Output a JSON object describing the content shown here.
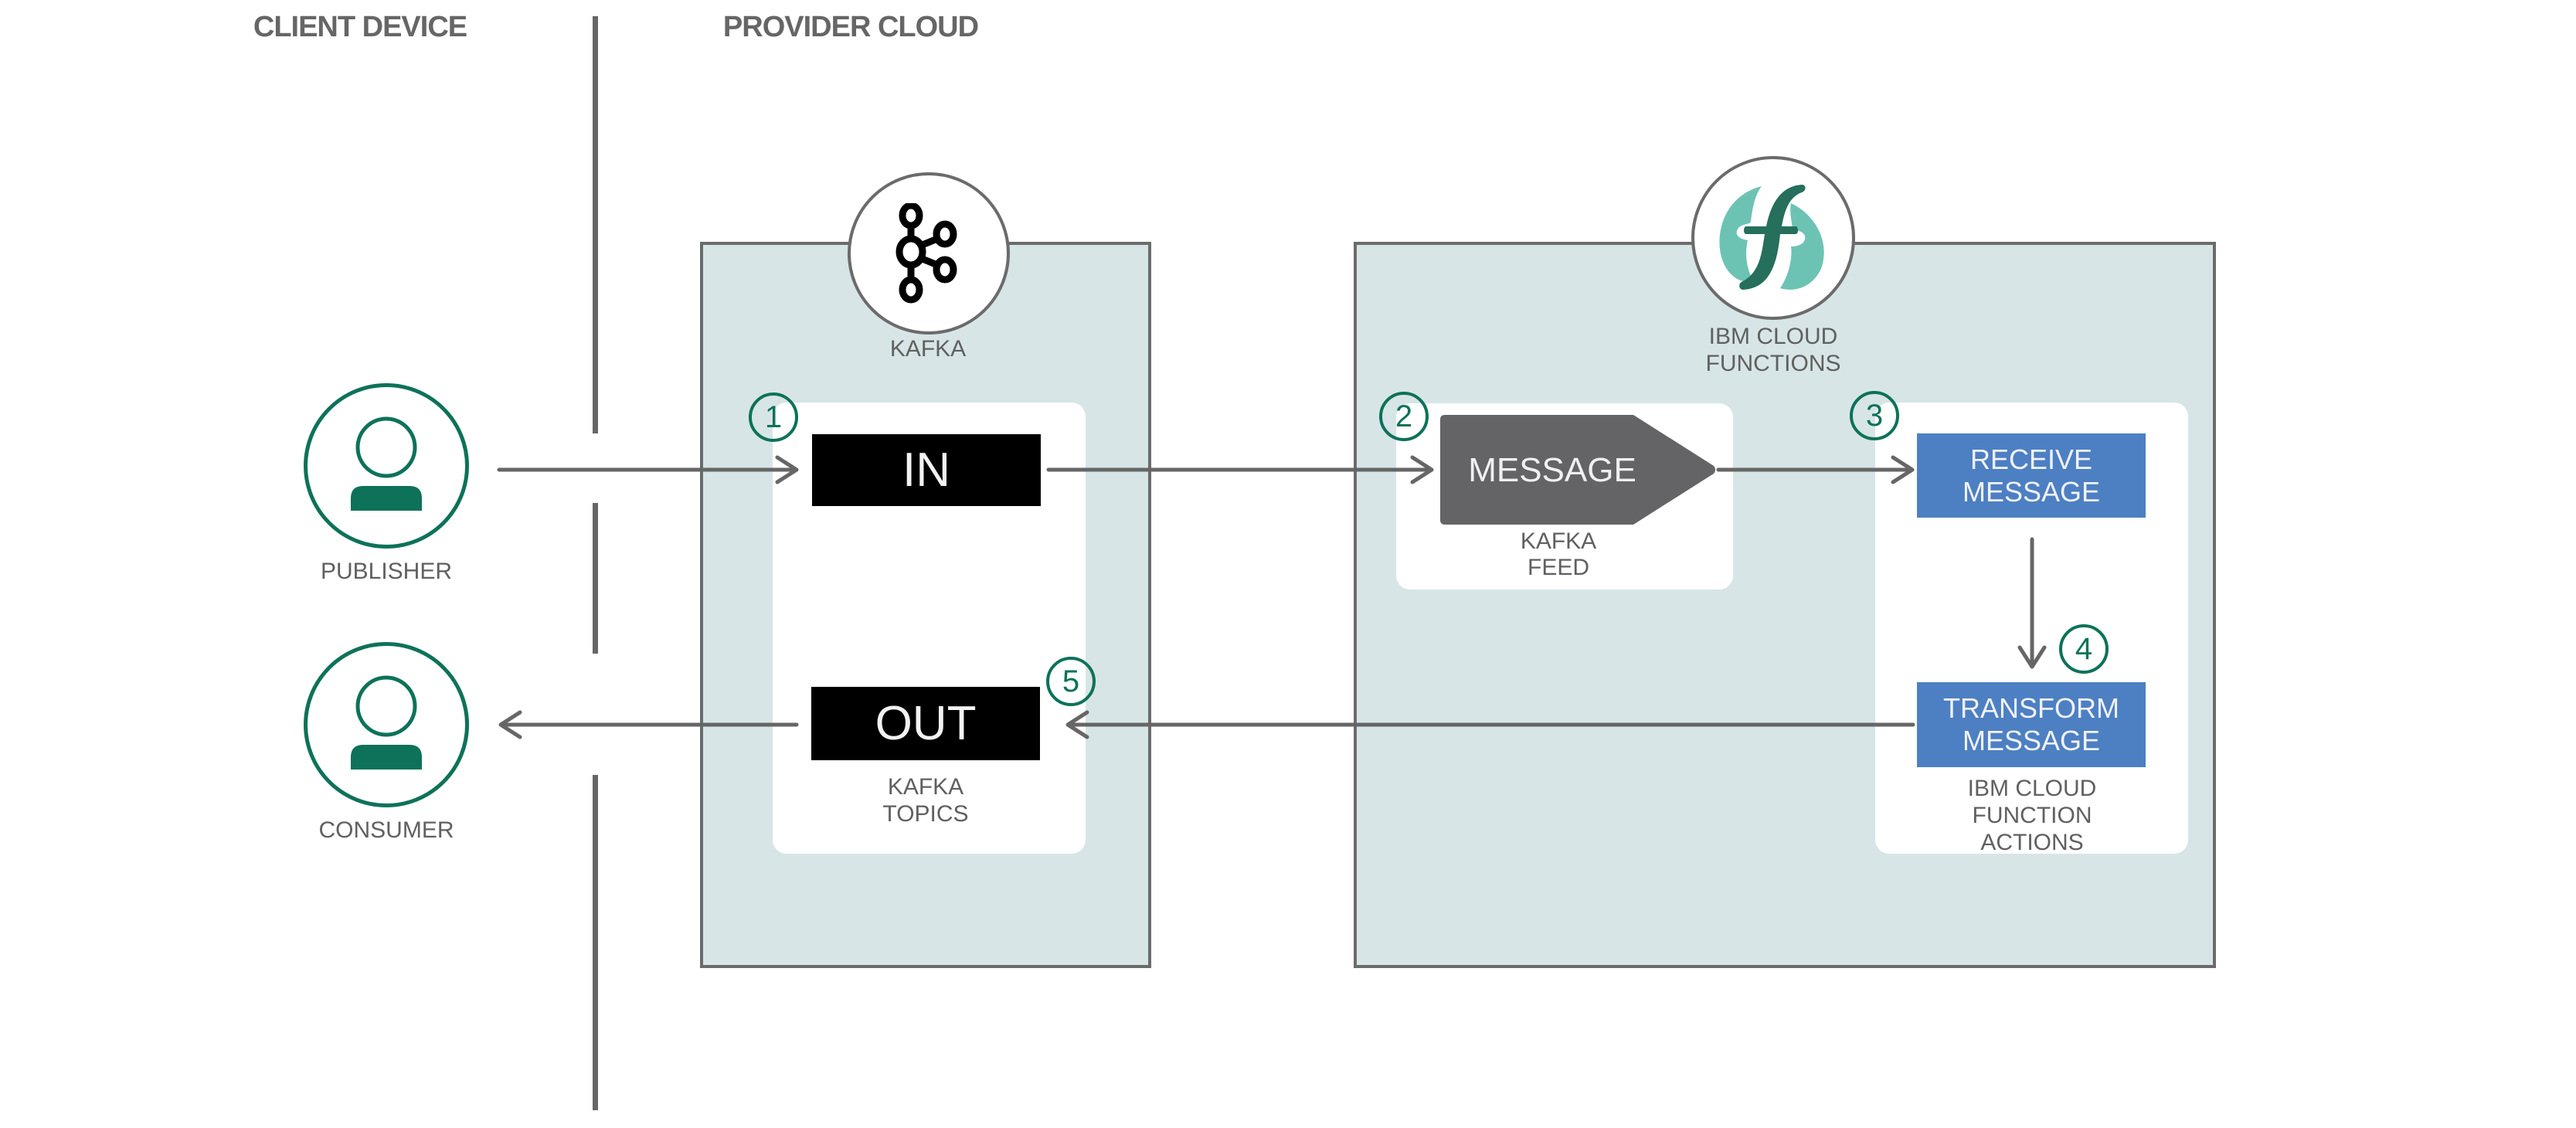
{
  "headers": {
    "client_device": "CLIENT DEVICE",
    "provider_cloud": "PROVIDER CLOUD"
  },
  "actors": {
    "publisher": {
      "label": "PUBLISHER",
      "icon": "user-icon"
    },
    "consumer": {
      "label": "CONSUMER",
      "icon": "user-icon"
    }
  },
  "kafka": {
    "logo_icon": "kafka-logo-icon",
    "label": "KAFKA",
    "in_label": "IN",
    "out_label": "OUT",
    "topics_label_1": "KAFKA",
    "topics_label_2": "TOPICS"
  },
  "functions": {
    "logo_icon": "ibm-cloud-functions-logo-icon",
    "label_1": "IBM CLOUD",
    "label_2": "FUNCTIONS",
    "message_label": "MESSAGE",
    "feed_label_1": "KAFKA",
    "feed_label_2": "FEED",
    "receive_label_1": "RECEIVE",
    "receive_label_2": "MESSAGE",
    "transform_label_1": "TRANSFORM",
    "transform_label_2": "MESSAGE",
    "actions_label_1": "IBM CLOUD",
    "actions_label_2": "FUNCTION",
    "actions_label_3": "ACTIONS"
  },
  "steps": [
    "1",
    "2",
    "3",
    "4",
    "5"
  ],
  "colors": {
    "accent_green": "#0d7259",
    "action_blue": "#4d7fc3",
    "container_bg": "#d7e5e6",
    "line_gray": "#666666",
    "logo_dark_green": "#256f5c",
    "logo_light_green": "#6cc3b4"
  }
}
